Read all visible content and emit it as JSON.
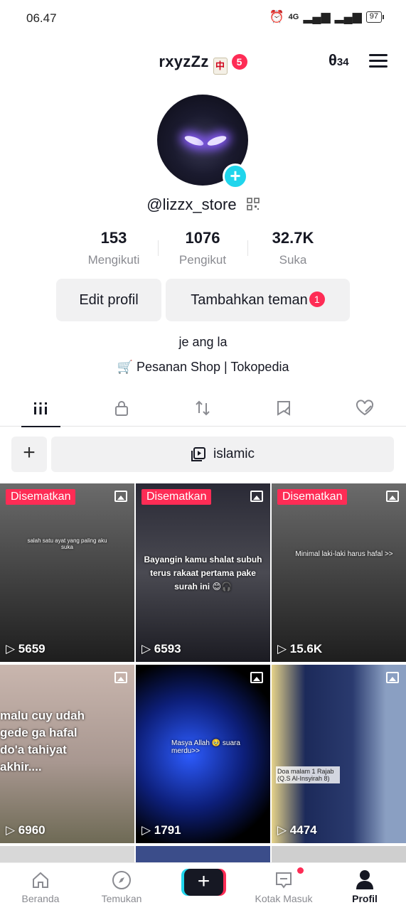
{
  "status": {
    "time": "06.47",
    "network": "4G",
    "battery": "97"
  },
  "header": {
    "username": "rxyzZz",
    "notif_count": "5",
    "icon_text": "θ",
    "icon_num": "34"
  },
  "profile": {
    "handle": "@lizzx_store",
    "bio": "je ang la",
    "shop_link": "Pesanan Shop | Tokopedia"
  },
  "stats": [
    {
      "value": "153",
      "label": "Mengikuti"
    },
    {
      "value": "1076",
      "label": "Pengikut"
    },
    {
      "value": "32.7K",
      "label": "Suka"
    }
  ],
  "buttons": {
    "edit": "Edit profil",
    "add_friends": "Tambahkan teman",
    "add_friends_count": "1"
  },
  "playlist": {
    "add": "+",
    "name": "islamic"
  },
  "videos": [
    {
      "pinned": "Disematkan",
      "views": "5659",
      "caption": "salah satu ayat yang paling aku suka"
    },
    {
      "pinned": "Disematkan",
      "views": "6593",
      "caption": "Bayangin kamu shalat subuh terus rakaat pertama pake surah ini 😊🎧"
    },
    {
      "pinned": "Disematkan",
      "views": "15.6K",
      "caption": "Minimal laki-laki harus hafal >>"
    },
    {
      "pinned": "",
      "views": "6960",
      "caption": "malu cuy udah gede ga hafal do'a tahiyat akhir...."
    },
    {
      "pinned": "",
      "views": "1791",
      "caption": "Masya Allah 🥹 suara merdu>>"
    },
    {
      "pinned": "",
      "views": "4474",
      "caption": "Doa malam 1 Rajab (Q.S Al-Insyirah 8)"
    }
  ],
  "nav": [
    {
      "label": "Beranda"
    },
    {
      "label": "Temukan"
    },
    {
      "label": ""
    },
    {
      "label": "Kotak Masuk"
    },
    {
      "label": "Profil"
    }
  ],
  "colors": {
    "accent": "#fe2c55",
    "cyan": "#20d5ec",
    "text": "#161823",
    "muted": "#8a8b91"
  }
}
